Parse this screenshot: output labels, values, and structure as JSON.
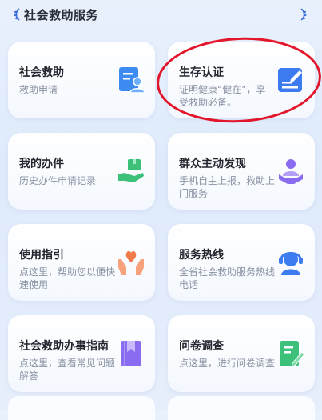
{
  "header": {
    "title": "社会救助服务"
  },
  "cards": [
    {
      "title": "社会救助",
      "subtitle": "救助申请",
      "icon": "person-document-icon",
      "color": "#3d8bf0"
    },
    {
      "title": "生存认证",
      "subtitle": "证明健康“健在”，享受救助必备。",
      "icon": "edit-document-icon",
      "color": "#3d7bf0"
    },
    {
      "title": "我的办件",
      "subtitle": "历史办件申请记录",
      "icon": "hand-box-icon",
      "color": "#3cc07a"
    },
    {
      "title": "群众主动发现",
      "subtitle": "手机自主上报，救助上门服务",
      "icon": "person-care-icon",
      "color": "#8a6cf0"
    },
    {
      "title": "使用指引",
      "subtitle": "点这里，帮助您以便快速使用",
      "icon": "hands-heart-icon",
      "color": "#f07a4a"
    },
    {
      "title": "服务热线",
      "subtitle": "全省社会救助服务热线电话",
      "icon": "headset-agent-icon",
      "color": "#3d7bf0"
    },
    {
      "title": "社会救助办事指南",
      "subtitle": "点这里，查看常见问题解答",
      "icon": "bookmark-book-icon",
      "color": "#8a6cf0"
    },
    {
      "title": "问卷调查",
      "subtitle": "点这里，进行问卷调查",
      "icon": "survey-edit-icon",
      "color": "#3cc07a"
    }
  ]
}
